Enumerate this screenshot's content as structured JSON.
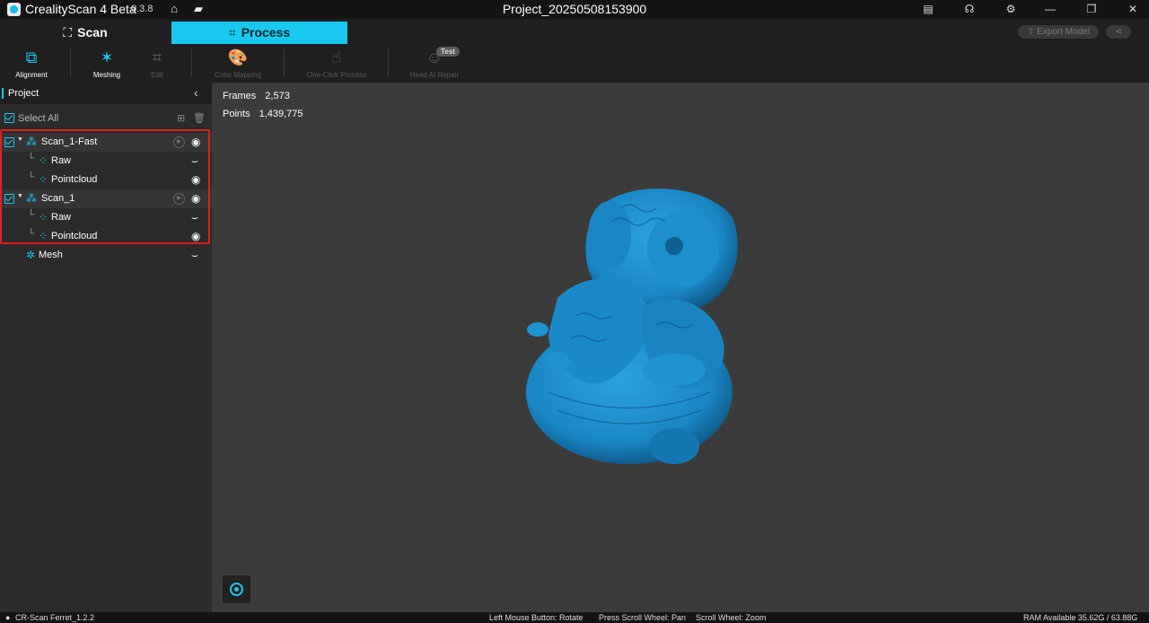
{
  "app": {
    "name": "CrealityScan 4 Beta",
    "version": "0.3.8",
    "project_title": "Project_20250508153900"
  },
  "mode_tabs": {
    "scan": "Scan",
    "process": "Process"
  },
  "header_actions": {
    "export": "Export Model"
  },
  "toolbar": {
    "alignment": "Alignment",
    "meshing": "Meshing",
    "edit": "Edit",
    "color_mapping": "Color Mapping",
    "one_click": "One-Click Process",
    "head_ai": "Head AI Repair",
    "test_badge": "Test"
  },
  "panel": {
    "title": "Project",
    "select_all": "Select All",
    "items": [
      {
        "label": "Scan_1-Fast",
        "kind": "group"
      },
      {
        "label": "Raw",
        "kind": "child",
        "visible": false
      },
      {
        "label": "Pointcloud",
        "kind": "child",
        "visible": true
      },
      {
        "label": "Scan_1",
        "kind": "group"
      },
      {
        "label": "Raw",
        "kind": "child",
        "visible": false
      },
      {
        "label": "Pointcloud",
        "kind": "child",
        "visible": true
      },
      {
        "label": "Mesh",
        "kind": "mesh",
        "visible": false
      }
    ]
  },
  "viewport": {
    "frames_label": "Frames",
    "frames_value": "2,573",
    "points_label": "Points",
    "points_value": "1,439,775",
    "model_color": "#1a86c4"
  },
  "status": {
    "device": "CR-Scan Ferret_1.2.2",
    "hint_rotate": "Left Mouse Button: Rotate",
    "hint_pan": "Press Scroll Wheel: Pan",
    "hint_zoom": "Scroll Wheel: Zoom",
    "ram": "RAM Available 35.62G / 63.88G"
  },
  "colors": {
    "accent": "#19c8ee",
    "highlight_border": "#e02020"
  }
}
